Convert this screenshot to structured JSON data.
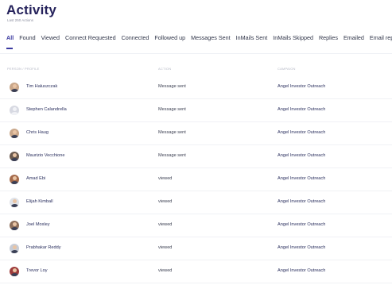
{
  "header": {
    "title": "Activity",
    "subtitle": "Last 250 Actions"
  },
  "tabs": [
    {
      "label": "All",
      "active": true
    },
    {
      "label": "Found",
      "active": false
    },
    {
      "label": "Viewed",
      "active": false
    },
    {
      "label": "Connect Requested",
      "active": false
    },
    {
      "label": "Connected",
      "active": false
    },
    {
      "label": "Followed up",
      "active": false
    },
    {
      "label": "Messages Sent",
      "active": false
    },
    {
      "label": "InMails Sent",
      "active": false
    },
    {
      "label": "InMails Skipped",
      "active": false
    },
    {
      "label": "Replies",
      "active": false
    },
    {
      "label": "Emailed",
      "active": false
    },
    {
      "label": "Email replies",
      "active": false
    }
  ],
  "table": {
    "columns": {
      "name": "PERSON / PROFILE",
      "action": "ACTION",
      "campaign": "CAMPAIGN"
    },
    "rows": [
      {
        "name": "Tim Haluszczak",
        "action": "Message sent",
        "campaign": "Angel Investor Outreach",
        "avatar": "photo"
      },
      {
        "name": "Stephen Calandrella",
        "action": "Message sent",
        "campaign": "Angel Investor Outreach",
        "avatar": "placeholder"
      },
      {
        "name": "Chris Haug",
        "action": "Message sent",
        "campaign": "Angel Investor Outreach",
        "avatar": "photo"
      },
      {
        "name": "Maurizio Vecchione",
        "action": "Message sent",
        "campaign": "Angel Investor Outreach",
        "avatar": "photo"
      },
      {
        "name": "Amad Ebi",
        "action": "viewed",
        "campaign": "Angel Investor Outreach",
        "avatar": "photo"
      },
      {
        "name": "Elijah Kimball",
        "action": "viewed",
        "campaign": "Angel Investor Outreach",
        "avatar": "photo"
      },
      {
        "name": "Joel Moxley",
        "action": "viewed",
        "campaign": "Angel Investor Outreach",
        "avatar": "photo"
      },
      {
        "name": "Prabhakar Reddy",
        "action": "viewed",
        "campaign": "Angel Investor Outreach",
        "avatar": "photo"
      },
      {
        "name": "Trevor Loy",
        "action": "viewed",
        "campaign": "Angel Investor Outreach",
        "avatar": "photo"
      }
    ]
  },
  "colors": {
    "accent": "#3b3aa0",
    "title": "#26235c",
    "link": "#2a2f5e"
  }
}
